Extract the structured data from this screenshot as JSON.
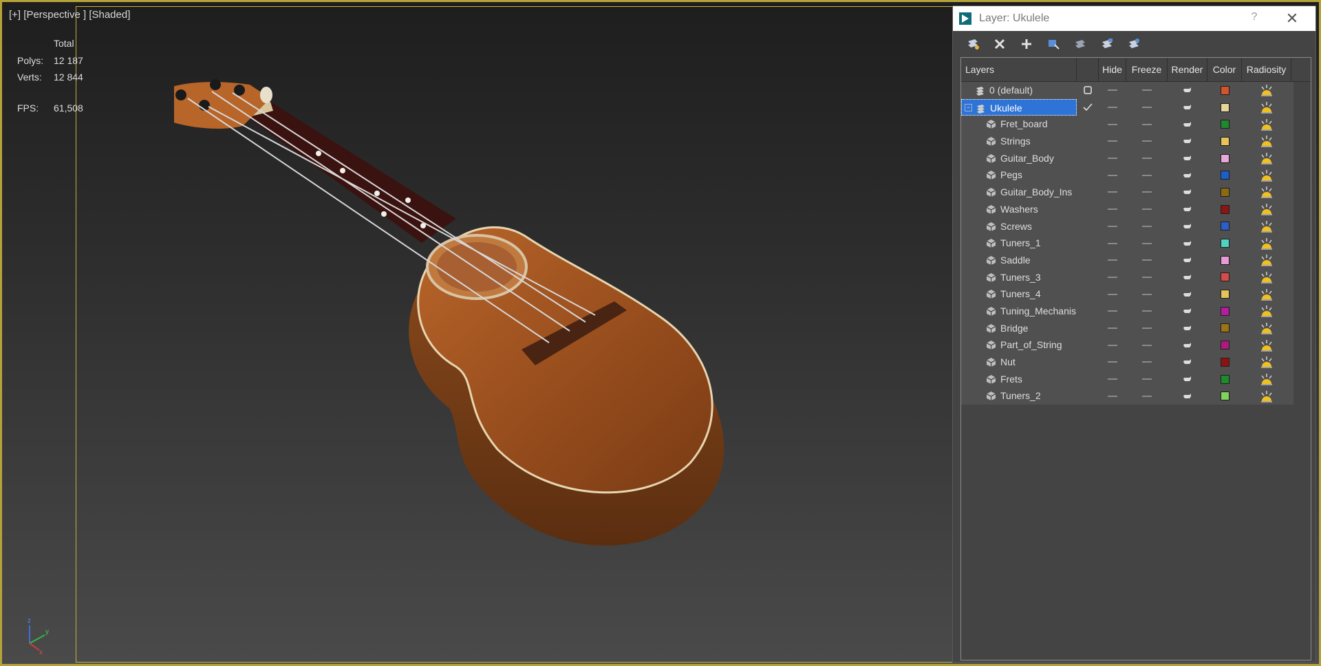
{
  "viewport": {
    "label_plus": "[+]",
    "label_view": "[Perspective ]",
    "label_shade": "[Shaded]",
    "stats": {
      "header": "Total",
      "polys_label": "Polys:",
      "polys": "12 187",
      "verts_label": "Verts:",
      "verts": "12 844",
      "fps_label": "FPS:",
      "fps": "61,508"
    },
    "axis": {
      "x": "x",
      "y": "y",
      "z": "z"
    }
  },
  "dialog": {
    "title": "Layer: Ukulele",
    "help": "?",
    "close": "✕",
    "toolbar": [
      "create-new-layer-icon",
      "delete-layer-icon",
      "add-to-layer-icon",
      "select-objects-icon",
      "highlight-selected-icon",
      "hide-all-layers-icon",
      "freeze-all-layers-icon"
    ],
    "columns": {
      "layers": "Layers",
      "hide": "Hide",
      "freeze": "Freeze",
      "render": "Render",
      "color": "Color",
      "radiosity": "Radiosity"
    },
    "rows": [
      {
        "name": "0 (default)",
        "kind": "layer",
        "color": "#d2542a"
      },
      {
        "name": "Ukulele",
        "kind": "layer",
        "selected": true,
        "current": true,
        "color": "#e6d59a"
      },
      {
        "name": "Fret_board",
        "kind": "object",
        "color": "#1f8a2c"
      },
      {
        "name": "Strings",
        "kind": "object",
        "color": "#e8c35a"
      },
      {
        "name": "Guitar_Body",
        "kind": "object",
        "color": "#e7a8d8"
      },
      {
        "name": "Pegs",
        "kind": "object",
        "color": "#1b5fcf"
      },
      {
        "name": "Guitar_Body_Ins",
        "kind": "object",
        "color": "#8c6a12"
      },
      {
        "name": "Washers",
        "kind": "object",
        "color": "#8b1515"
      },
      {
        "name": "Screws",
        "kind": "object",
        "color": "#2d5dc9"
      },
      {
        "name": "Tuners_1",
        "kind": "object",
        "color": "#4fd2c1"
      },
      {
        "name": "Saddle",
        "kind": "object",
        "color": "#e79ad7"
      },
      {
        "name": "Tuners_3",
        "kind": "object",
        "color": "#d84a4a"
      },
      {
        "name": "Tuners_4",
        "kind": "object",
        "color": "#e6c45a"
      },
      {
        "name": "Tuning_Mechanis",
        "kind": "object",
        "color": "#b31d9e"
      },
      {
        "name": "Bridge",
        "kind": "object",
        "color": "#9c7414"
      },
      {
        "name": "Part_of_String",
        "kind": "object",
        "color": "#b0187f"
      },
      {
        "name": "Nut",
        "kind": "object",
        "color": "#8f1212"
      },
      {
        "name": "Frets",
        "kind": "object",
        "color": "#1c8c2a"
      },
      {
        "name": "Tuners_2",
        "kind": "object",
        "color": "#7fd35b"
      }
    ]
  }
}
